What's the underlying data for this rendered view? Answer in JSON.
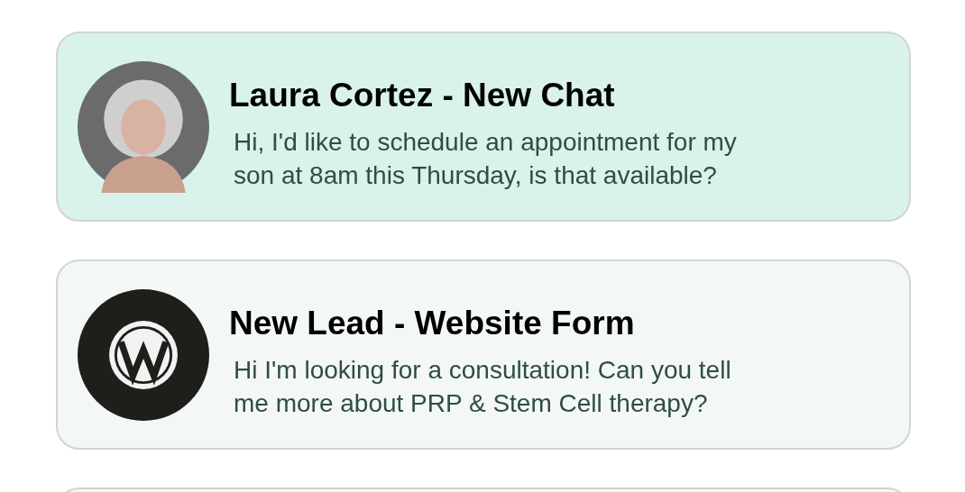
{
  "conversations": [
    {
      "selected": true,
      "kind": "photo",
      "title": "Laura Cortez - New Chat",
      "message": "Hi, I'd like to schedule an appointment for my son at 8am this Thursday, is that available?"
    },
    {
      "selected": false,
      "kind": "logo",
      "title": "New Lead - Website Form",
      "message": "Hi I'm looking for a consultation! Can you tell me more about PRP & Stem Cell therapy?"
    },
    {
      "selected": false,
      "kind": "blank"
    }
  ]
}
